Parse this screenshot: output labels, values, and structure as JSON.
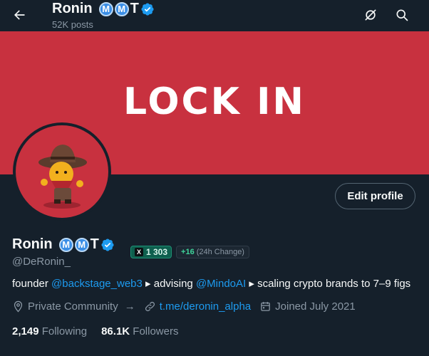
{
  "header": {
    "name": "Ronin",
    "badge_1": "M",
    "badge_2": "M",
    "badge_3": "T",
    "posts": "52K posts"
  },
  "icons": {
    "back": "back-arrow-icon",
    "grok": "grok-icon",
    "search": "search-icon",
    "verified": "verified-badge-icon",
    "location": "location-pin-icon",
    "link": "link-icon",
    "calendar": "calendar-icon"
  },
  "banner": {
    "text": "LOCK IN",
    "color": "#c8313f"
  },
  "profile": {
    "name": "Ronin",
    "badge_1": "M",
    "badge_2": "M",
    "badge_3": "T",
    "handle": "@DeRonin_",
    "edit_label": "Edit profile"
  },
  "score": {
    "x_label": "X",
    "value": "1 303",
    "delta": "+16",
    "delta_note": "(24h Change)"
  },
  "bio": {
    "prefix": "founder ",
    "link_1": "@backstage_web3",
    "mid": " ▸ advising ",
    "link_2": "@MindoAI",
    "suffix": " ▸ scaling crypto brands to 7–9 figs"
  },
  "meta": {
    "community": "Private Community",
    "arrow": "→",
    "url": "t.me/deronin_alpha",
    "joined": "Joined July 2021"
  },
  "stats": {
    "following_count": "2,149",
    "following_label": "Following",
    "followers_count": "86.1K",
    "followers_label": "Followers"
  },
  "colors": {
    "background": "#15202b",
    "accent": "#1d9bf0",
    "muted": "#8b98a5"
  }
}
